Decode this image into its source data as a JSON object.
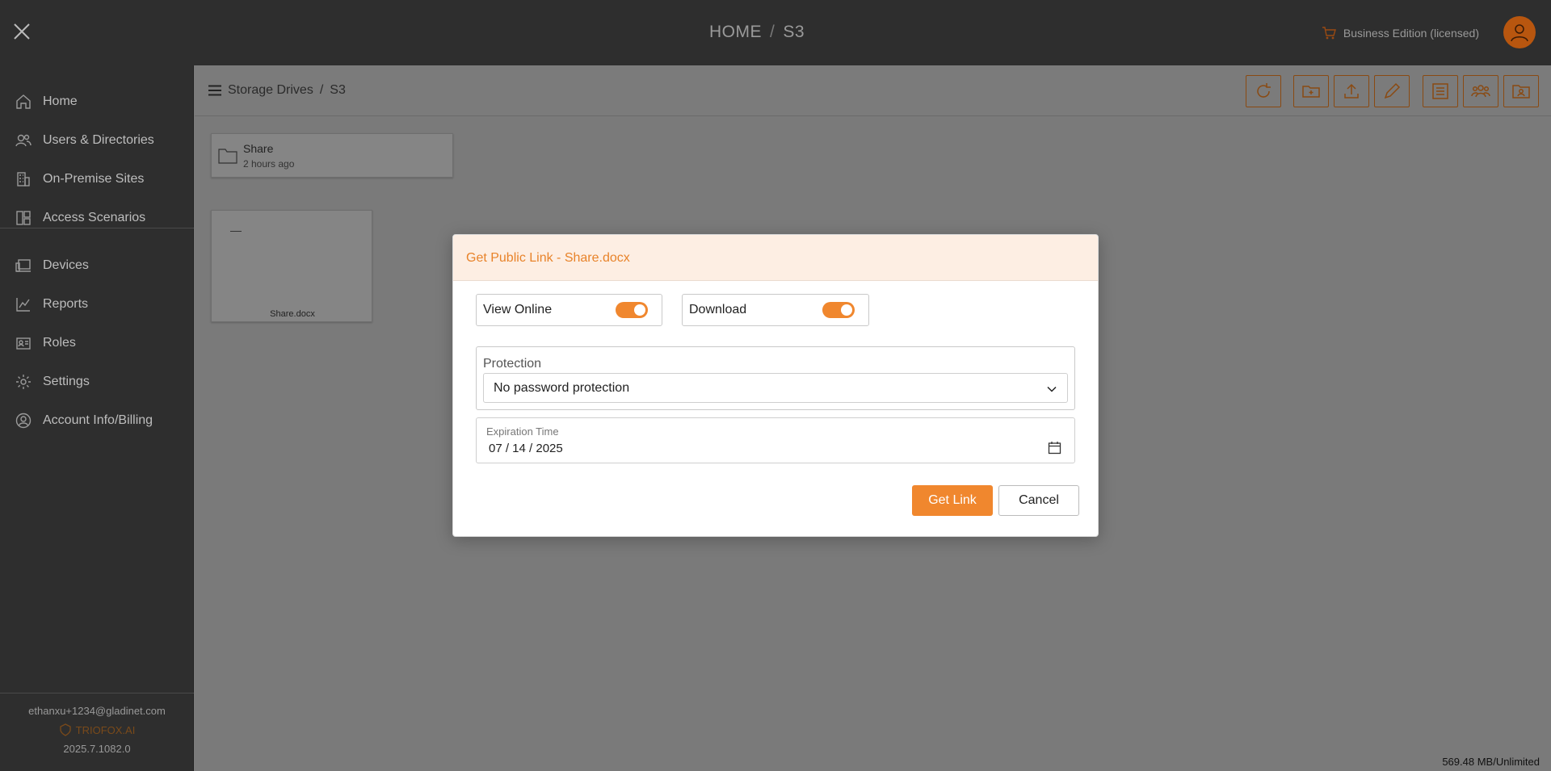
{
  "topbar": {
    "title_home": "HOME",
    "title_sep": "/",
    "title_current": "S3",
    "license": "Business Edition (licensed)"
  },
  "sidebar": {
    "items": [
      {
        "label": "Home",
        "icon": "home-icon"
      },
      {
        "label": "Users & Directories",
        "icon": "users-icon"
      },
      {
        "label": "On-Premise Sites",
        "icon": "building-icon"
      },
      {
        "label": "Access Scenarios",
        "icon": "layout-icon"
      },
      {
        "label": "Devices",
        "icon": "devices-icon"
      },
      {
        "label": "Reports",
        "icon": "chart-icon"
      },
      {
        "label": "Roles",
        "icon": "id-card-icon"
      },
      {
        "label": "Settings",
        "icon": "gear-icon"
      },
      {
        "label": "Account Info/Billing",
        "icon": "account-icon"
      }
    ],
    "footer": {
      "email": "ethanxu+1234@gladinet.com",
      "brand": "TRIOFOX.AI",
      "version": "2025.7.1082.0"
    }
  },
  "breadcrumb": {
    "root": "Storage Drives",
    "sep": "/",
    "current": "S3"
  },
  "content": {
    "folder": {
      "name": "Share",
      "time": "2 hours ago"
    },
    "file": {
      "name": "Share.docx"
    }
  },
  "usage": "569.48 MB/Unlimited",
  "dialog": {
    "title": "Get Public Link - Share.docx",
    "view_online": {
      "label": "View Online",
      "enabled": true
    },
    "download": {
      "label": "Download",
      "enabled": true
    },
    "protection_label": "Protection",
    "protection_value": "No password protection",
    "expiration_label": "Expiration Time",
    "expiration_value": "07 / 14 / 2025",
    "get_link": "Get Link",
    "cancel": "Cancel"
  },
  "colors": {
    "accent": "#f0872e",
    "dialog_header_bg": "#fdeee3",
    "sidebar_bg": "#2e2e2e",
    "overlay": "#7a7a7a"
  }
}
